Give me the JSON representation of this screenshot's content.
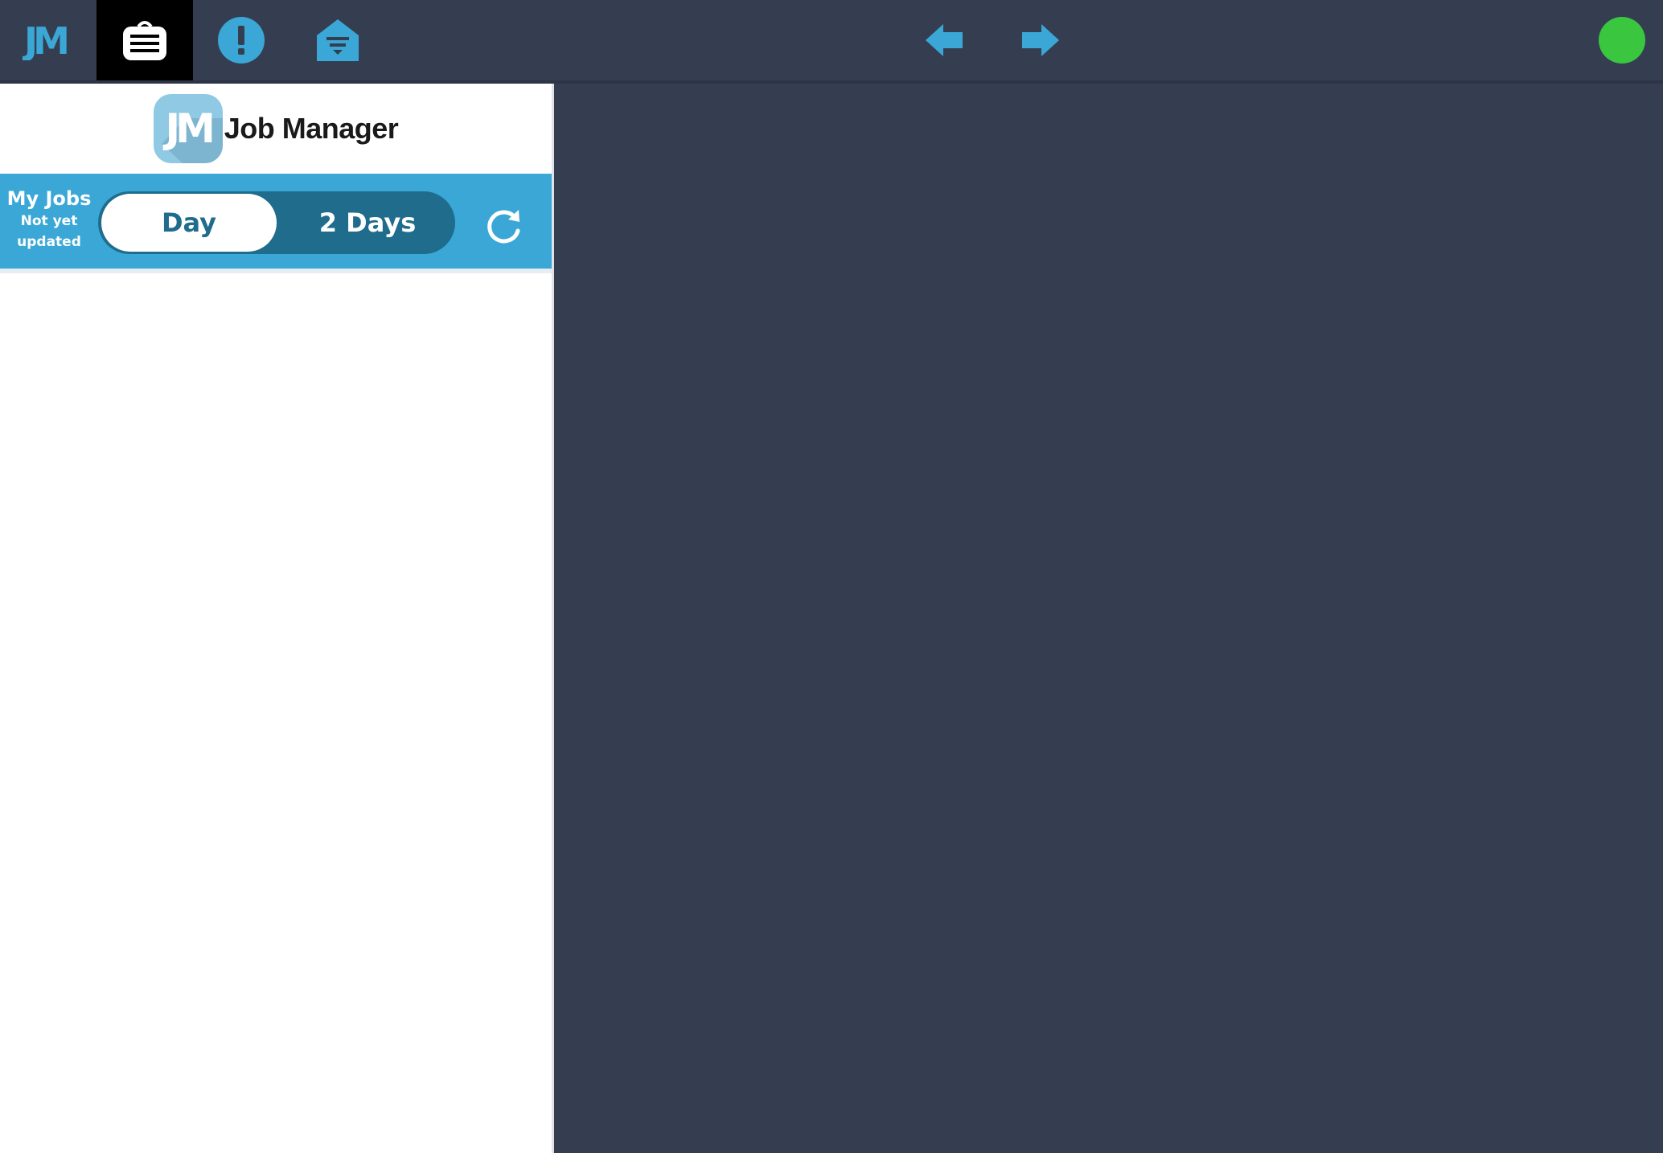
{
  "colors": {
    "background": "#353e51",
    "accent": "#3aa7d6",
    "toggle_dark": "#1f6c8c",
    "status_online": "#3ac63f"
  },
  "topbar": {
    "buttons": [
      {
        "name": "jm-logo-icon"
      },
      {
        "name": "jobs-list-icon",
        "active": true
      },
      {
        "name": "alerts-icon"
      },
      {
        "name": "inbox-icon"
      }
    ],
    "nav": {
      "back": "arrow-left-icon",
      "forward": "arrow-right-icon"
    },
    "status": "status-online-indicator"
  },
  "brand": {
    "logo_letters": "JM",
    "title": "Job Manager"
  },
  "jobs": {
    "title": "My Jobs",
    "status_line1": "Not yet",
    "status_line2": "updated",
    "range_options": [
      "Day",
      "2 Days"
    ],
    "selected_range": "Day",
    "refresh_icon": "refresh-icon"
  }
}
